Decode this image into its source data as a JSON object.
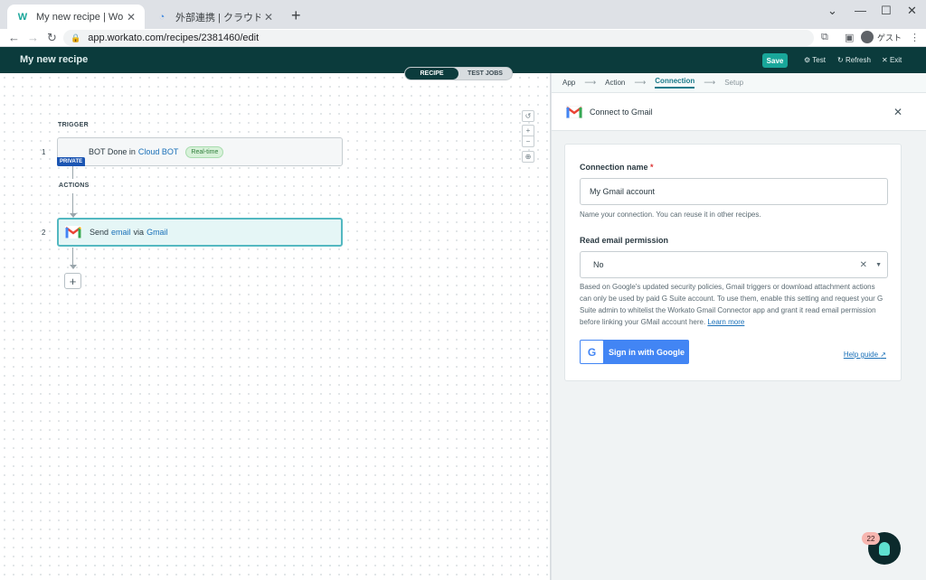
{
  "browser": {
    "tabs": [
      {
        "title": "My new recipe | Workato",
        "favicon": "W"
      },
      {
        "title": "外部連携 | クラウドBOT",
        "favicon": "C"
      }
    ],
    "url": "app.workato.com/recipes/2381460/edit",
    "guest_label": "ゲスト"
  },
  "header": {
    "recipe_name": "My new recipe",
    "save": "Save",
    "test": "Test",
    "refresh": "Refresh",
    "exit": "Exit"
  },
  "canvas": {
    "toggle": {
      "recipe": "RECIPE",
      "test_jobs": "TEST JOBS"
    },
    "trigger_label": "TRIGGER",
    "actions_label": "ACTIONS",
    "trigger_step": {
      "num": "1",
      "prefix": "BOT Done in",
      "app": "Cloud BOT",
      "badge": "Real-time",
      "private": "PRIVATE"
    },
    "action_step": {
      "num": "2",
      "verb": "Send",
      "object": "email",
      "via": "via",
      "app": "Gmail"
    },
    "add": "+"
  },
  "panel": {
    "crumbs": [
      "App",
      "Action",
      "Connection",
      "Setup"
    ],
    "title": "Connect to Gmail",
    "form": {
      "conn_label": "Connection name",
      "conn_required": "*",
      "conn_value": "My Gmail account",
      "conn_hint": "Name your connection. You can reuse it in other recipes.",
      "perm_label": "Read email permission",
      "perm_value": "No",
      "perm_hint": "Based on Google's updated security policies, Gmail triggers or download attachment actions can only be used by paid G Suite account. To use them, enable this setting and request your G Suite admin to whitelist the Workato Gmail Connector app and grant it read email permission before linking your GMail account here.",
      "learn_more": "Learn more",
      "google_btn": "Sign in with Google",
      "help_guide": "Help guide"
    }
  },
  "fab": {
    "count": "22"
  },
  "colors": {
    "header_bg": "#0b3b3c",
    "accent": "#19a69a",
    "link": "#1a70b8",
    "google_blue": "#4285f4"
  }
}
